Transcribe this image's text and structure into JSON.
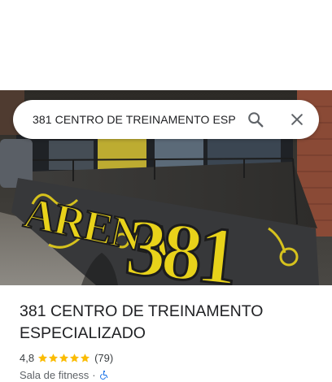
{
  "search": {
    "query": "381 CENTRO DE TREINAMENTO ESP"
  },
  "place": {
    "title": "381 CENTRO DE TREINAMENTO ESPECIALIZADO",
    "rating": "4,8",
    "stars": 4.8,
    "review_count": "(79)",
    "category": "Sala de fitness",
    "separator": "·"
  },
  "photo": {
    "graffiti_left": "ARENA",
    "graffiti_right": "381"
  },
  "colors": {
    "star": "#fbbc04",
    "graffiti": "#e8d21a",
    "accessibility": "#1a73e8"
  },
  "icons": {
    "search": "search-icon",
    "close": "close-icon",
    "star": "star-icon",
    "accessibility": "wheelchair-icon"
  }
}
